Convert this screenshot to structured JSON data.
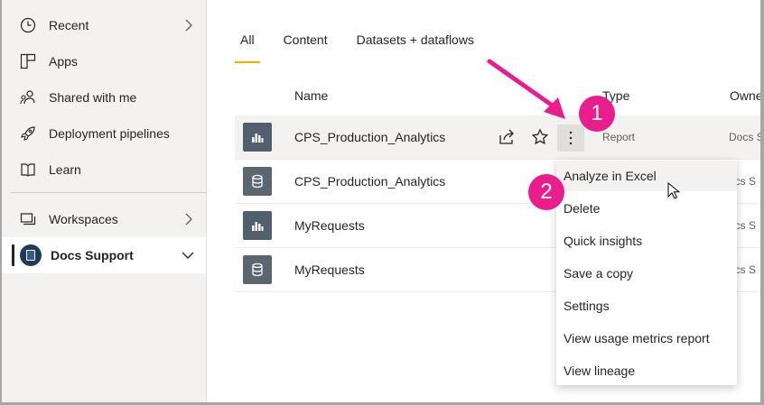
{
  "sidebar": {
    "items": [
      {
        "label": "Recent",
        "icon": "clock-icon"
      },
      {
        "label": "Apps",
        "icon": "apps-icon"
      },
      {
        "label": "Shared with me",
        "icon": "shared-icon"
      },
      {
        "label": "Deployment pipelines",
        "icon": "rocket-icon"
      },
      {
        "label": "Learn",
        "icon": "book-icon"
      }
    ],
    "workspaces_label": "Workspaces",
    "active_workspace": "Docs Support"
  },
  "tabs": [
    "All",
    "Content",
    "Datasets + dataflows"
  ],
  "columns": {
    "name": "Name",
    "type": "Type",
    "owner": "Owne"
  },
  "rows": [
    {
      "name": "CPS_Production_Analytics",
      "type": "Report",
      "owner": "Docs S",
      "icon": "report-icon"
    },
    {
      "name": "CPS_Production_Analytics",
      "type": "",
      "owner": "ocs S",
      "icon": "dataset-icon"
    },
    {
      "name": "MyRequests",
      "type": "",
      "owner": "ocs S",
      "icon": "report-icon"
    },
    {
      "name": "MyRequests",
      "type": "",
      "owner": "ocs S",
      "icon": "dataset-icon"
    }
  ],
  "menu": [
    "Analyze in Excel",
    "Delete",
    "Quick insights",
    "Save a copy",
    "Settings",
    "View usage metrics report",
    "View lineage"
  ],
  "callouts": {
    "one": "1",
    "two": "2"
  },
  "colors": {
    "accent": "#e8b200",
    "callout": "#e91e8c",
    "sidebar_bg": "#f3f2f1",
    "icon_bg": "#52606d"
  }
}
